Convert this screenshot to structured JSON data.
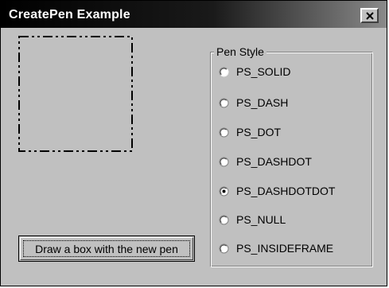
{
  "window": {
    "title": "CreatePen Example",
    "close_glyph": "✕"
  },
  "preview": {
    "pen_style_shown": "PS_DASHDOTDOT",
    "stroke_color": "#000000"
  },
  "button": {
    "label": "Draw a box with the new pen"
  },
  "pen_style_group": {
    "label": "Pen Style",
    "options": [
      {
        "label": "PS_SOLID",
        "selected": false
      },
      {
        "label": "PS_DASH",
        "selected": false
      },
      {
        "label": "PS_DOT",
        "selected": false
      },
      {
        "label": "PS_DASHDOT",
        "selected": false
      },
      {
        "label": "PS_DASHDOTDOT",
        "selected": true
      },
      {
        "label": "PS_NULL",
        "selected": false
      },
      {
        "label": "PS_INSIDEFRAME",
        "selected": false
      }
    ]
  },
  "colors": {
    "face": "#c0c0c0",
    "title_start": "#000000",
    "title_end": "#8a8a8a",
    "title_text": "#ffffff"
  }
}
